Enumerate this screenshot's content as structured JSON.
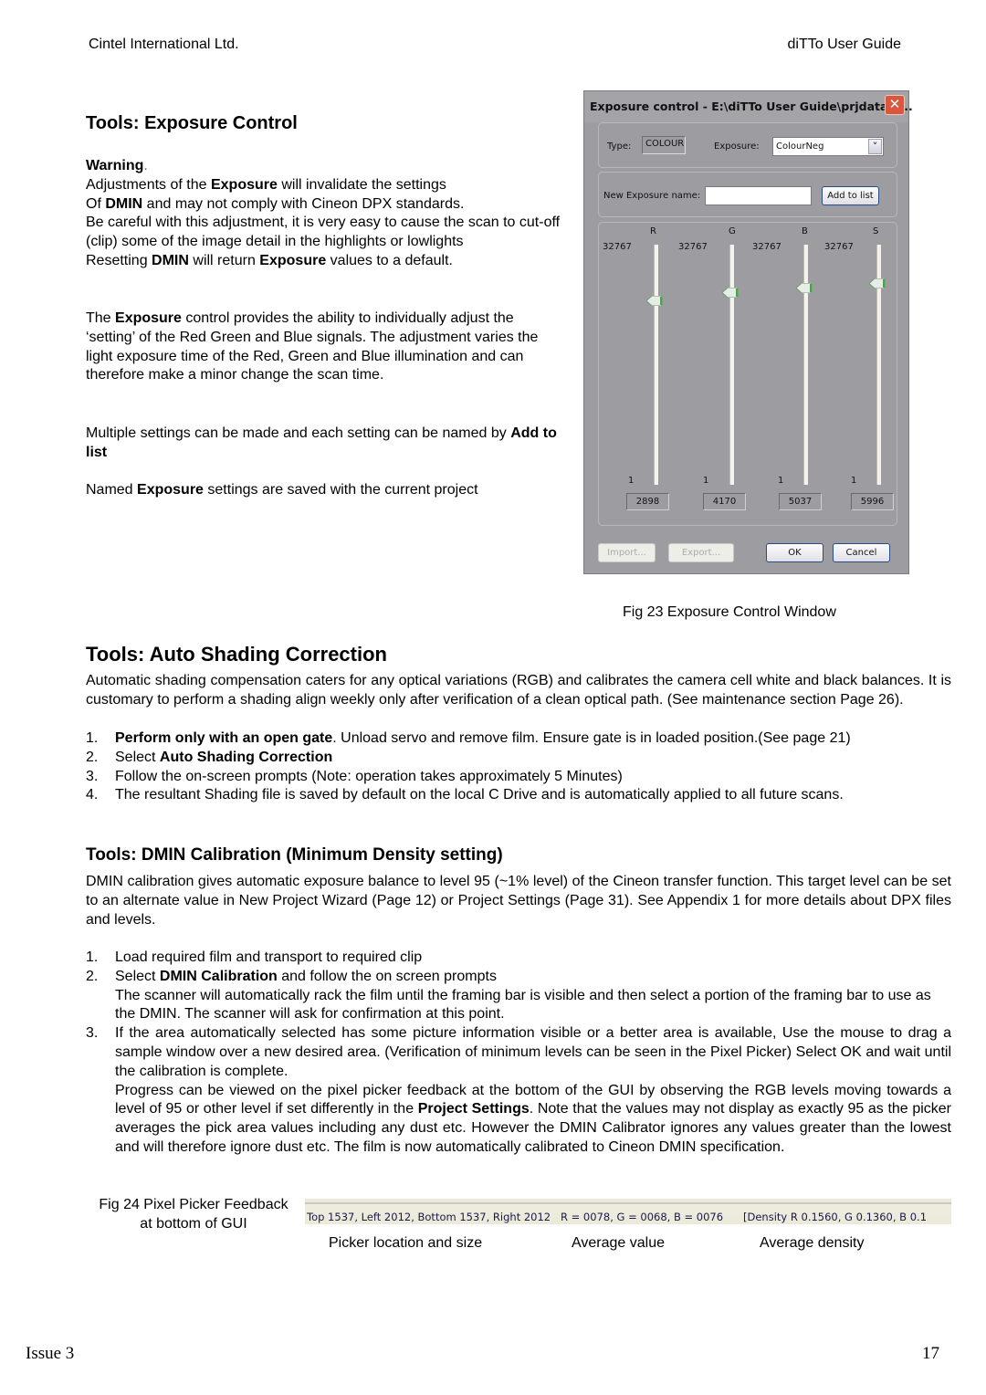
{
  "header": {
    "left": "Cintel International Ltd.",
    "right": "diTTo User Guide"
  },
  "exposure_section": {
    "title": "Tools: Exposure Control",
    "warning_label": "Warning",
    "warning_dot": ".",
    "warning_lines": [
      {
        "pre": "Adjustments of the ",
        "bold": "Exposure",
        "post": " will invalidate the settings"
      },
      {
        "pre": "Of ",
        "bold": "DMIN",
        "post": " and may not comply with Cineon DPX standards."
      }
    ],
    "careful_text": "Be careful with this adjustment, it is very easy to cause the scan to cut-off (clip) some of the image detail in the highlights or lowlights",
    "resetting": {
      "pre": "Resetting ",
      "b1": "DMIN",
      "mid": " will return ",
      "b2": "Exposure",
      "post": " values to a default."
    },
    "para1": {
      "pre": "The ",
      "bold": "Exposure",
      "post": " control provides the ability to individually adjust the ‘setting’ of the Red Green and Blue signals. The adjustment varies the light exposure time of the Red, Green and Blue illumination and can therefore make a minor change the scan time."
    },
    "para2": {
      "pre": "Multiple settings can be made and each setting can be named by ",
      "bold": "Add to list"
    },
    "para3": {
      "pre": "Named ",
      "bold": "Exposure",
      "post": " settings are saved with the current project"
    }
  },
  "dialog": {
    "title": "Exposure control - E:\\diTTo User Guide\\prjdata\\e...",
    "close_glyph": "✕",
    "type_label": "Type:",
    "type_value": "COLOUR",
    "exposure_label": "Exposure:",
    "exposure_value": "ColourNeg",
    "dropdown_glyph": "˅",
    "new_name_label": "New Exposure name:",
    "new_name_value": "",
    "add_button": "Add to list",
    "channels": [
      {
        "label": "R",
        "max": "32767",
        "min": "1",
        "value": "2898"
      },
      {
        "label": "G",
        "max": "32767",
        "min": "1",
        "value": "4170"
      },
      {
        "label": "B",
        "max": "32767",
        "min": "1",
        "value": "5037"
      },
      {
        "label": "S",
        "max": "32767",
        "min": "1",
        "value": "5996"
      }
    ],
    "import_button": "Import...",
    "export_button": "Export...",
    "ok_button": "OK",
    "cancel_button": "Cancel"
  },
  "fig23_caption": "Fig 23 Exposure Control Window",
  "shading_section": {
    "title": "Tools: Auto Shading Correction",
    "intro": "Automatic shading compensation caters for any optical variations (RGB) and calibrates the camera cell white and black balances. It is customary to perform a shading align weekly only after verification of a clean optical path. (See maintenance section Page 26).",
    "steps": [
      {
        "num": "1.",
        "bold": "Perform only with an open gate",
        "text": ". Unload servo and remove film. Ensure gate is in loaded position.(See page 21)"
      },
      {
        "num": "2.",
        "pre": "Select ",
        "bold": "Auto Shading Correction",
        "text": ""
      },
      {
        "num": "3.",
        "text": "Follow the on-screen prompts (Note: operation takes approximately 5 Minutes)"
      },
      {
        "num": "4.",
        "text": "The resultant Shading file is saved by default on the local C Drive and is automatically applied to all future scans."
      }
    ]
  },
  "dmin_section": {
    "title": "Tools: DMIN Calibration (Minimum Density setting)",
    "intro": "DMIN calibration gives automatic exposure balance to level 95 (~1% level) of the Cineon transfer function.  This target level can be set to an alternate value in New Project Wizard (Page 12) or Project Settings (Page 31).  See Appendix 1 for more details about DPX files and levels.",
    "steps": [
      {
        "num": "1.",
        "text": "Load  required film and transport to required clip"
      },
      {
        "num": "2.",
        "pre": "Select ",
        "bold": "DMIN Calibration",
        "text": " and follow the on screen prompts",
        "extra": "The scanner will automatically rack the film until the framing bar is visible and then select a portion of the framing bar to use as the DMIN.  The scanner will ask for confirmation at this point."
      },
      {
        "num": "3.",
        "text": "If the area automatically selected has some picture information visible or a better area is available, Use the mouse to drag a sample window over a new desired area. (Verification of minimum levels can be seen in the Pixel Picker) Select OK and wait until the calibration is complete.",
        "extra_pre": "Progress can be viewed on the pixel picker feedback at the bottom of the GUI by observing the RGB levels moving towards a level of 95 or other level if set differently in the ",
        "extra_bold": "Project Settings",
        "extra_post": ". Note that the values may not display as exactly 95 as the picker averages the pick area values including any dust etc. However the  DMIN Calibrator ignores any values greater than the lowest and will therefore ignore dust etc. The film is now automatically calibrated to Cineon DMIN specification."
      }
    ]
  },
  "fig24": {
    "caption_line1": "Fig 24 Pixel Picker Feedback",
    "caption_line2": "at bottom of GUI",
    "location": "Top 1537, Left 2012, Bottom 1537, Right 2012",
    "average": "R = 0078,  G = 0068,  B = 0076",
    "density": "[Density R  0.1560,  G  0.1360,  B  0.1",
    "label_location": "Picker location and size",
    "label_average": "Average value",
    "label_density": "Average density"
  },
  "footer": {
    "left": "Issue 3",
    "right": "17"
  }
}
